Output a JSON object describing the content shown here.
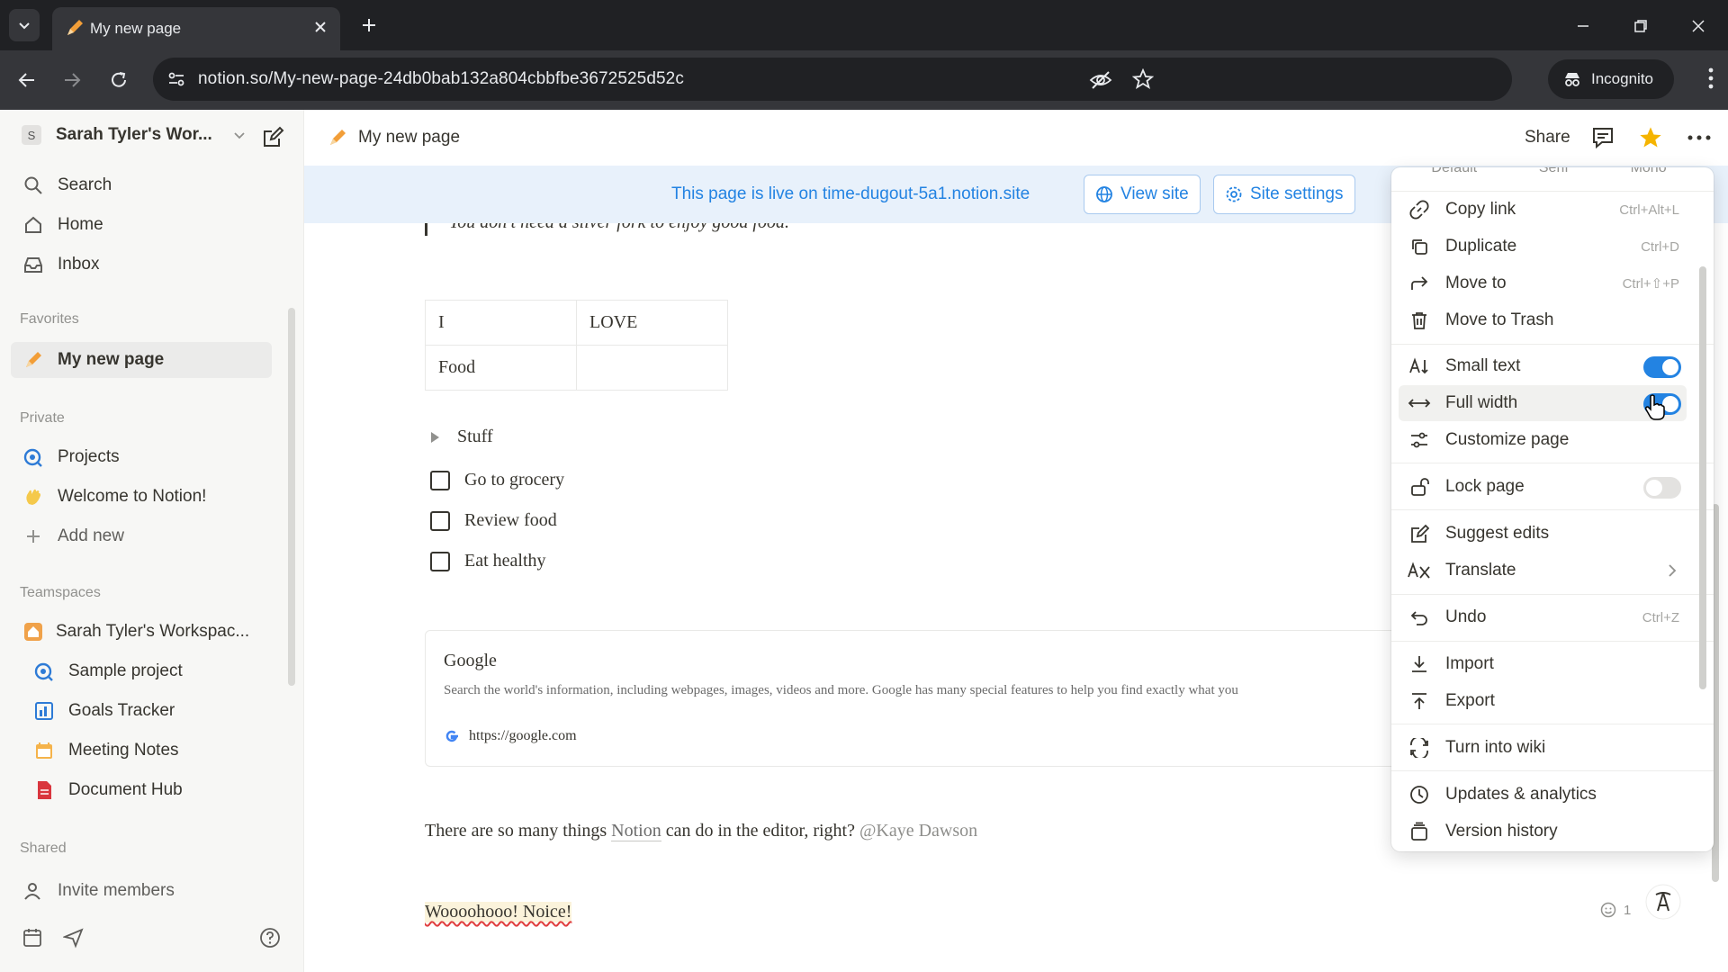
{
  "browser": {
    "tab_title": "My new page",
    "url": "notion.so/My-new-page-24db0bab132a804cbbfbe3672525d52c",
    "incognito_label": "Incognito"
  },
  "sidebar": {
    "workspace_initial": "S",
    "workspace_name": "Sarah Tyler's Wor...",
    "top_items": [
      {
        "label": "Search",
        "icon": "search-icon"
      },
      {
        "label": "Home",
        "icon": "home-icon"
      },
      {
        "label": "Inbox",
        "icon": "inbox-icon"
      }
    ],
    "favorites_heading": "Favorites",
    "favorites": [
      {
        "label": "My new page",
        "icon": "pencil-icon"
      }
    ],
    "private_heading": "Private",
    "private": [
      {
        "label": "Projects",
        "icon": "projects-icon"
      },
      {
        "label": "Welcome to Notion!",
        "icon": "wave-hand-icon"
      },
      {
        "label": "Add new",
        "icon": "plus-icon"
      }
    ],
    "teamspaces_heading": "Teamspaces",
    "teamspaces": [
      {
        "label": "Sarah Tyler's Workspac...",
        "icon": "house-icon"
      },
      {
        "label": "Sample project",
        "icon": "projects-icon"
      },
      {
        "label": "Goals Tracker",
        "icon": "chart-icon"
      },
      {
        "label": "Meeting Notes",
        "icon": "calendar-icon"
      },
      {
        "label": "Document Hub",
        "icon": "document-icon"
      }
    ],
    "shared_heading": "Shared",
    "invite_label": "Invite members"
  },
  "topbar": {
    "breadcrumb": "My new page",
    "share_label": "Share"
  },
  "banner": {
    "message": "This page is live on time-dugout-5a1.notion.site",
    "view_site": "View site",
    "site_settings": "Site settings"
  },
  "page": {
    "quote": "You don't need a silver fork to enjoy good food.",
    "table": [
      [
        "I",
        "LOVE"
      ],
      [
        "Food",
        ""
      ]
    ],
    "toggle": "Stuff",
    "todos": [
      "Go to grocery",
      "Review food",
      "Eat healthy"
    ],
    "bookmark": {
      "title": "Google",
      "description": "Search the world's information, including webpages, images, videos and more. Google has many special features to help you find exactly what you",
      "url": "https://google.com"
    },
    "para1_a": "There are so many things ",
    "para1_link": "Notion",
    "para1_b": " can do in the editor, right? ",
    "para1_mention": "@Kaye Dawson",
    "para2": "Woooohooo! Noice!",
    "reaction_count": "1"
  },
  "menu": {
    "fonts": [
      "Default",
      "Serif",
      "Mono"
    ],
    "items": [
      {
        "label": "Copy link",
        "shortcut": "Ctrl+Alt+L",
        "icon": "link-icon"
      },
      {
        "label": "Duplicate",
        "shortcut": "Ctrl+D",
        "icon": "duplicate-icon"
      },
      {
        "label": "Move to",
        "shortcut": "Ctrl+⇧+P",
        "icon": "move-arrow-icon"
      },
      {
        "label": "Move to Trash",
        "shortcut": "",
        "icon": "trash-icon"
      },
      {
        "label": "Small text",
        "toggle": true,
        "icon": "small-text-icon"
      },
      {
        "label": "Full width",
        "toggle": true,
        "icon": "full-width-icon"
      },
      {
        "label": "Customize page",
        "icon": "sliders-icon"
      },
      {
        "label": "Lock page",
        "toggle": false,
        "icon": "lock-icon"
      },
      {
        "label": "Suggest edits",
        "icon": "suggest-edit-icon"
      },
      {
        "label": "Translate",
        "icon": "translate-icon"
      },
      {
        "label": "Undo",
        "shortcut": "Ctrl+Z",
        "icon": "undo-icon"
      },
      {
        "label": "Import",
        "icon": "import-icon"
      },
      {
        "label": "Export",
        "icon": "export-icon"
      },
      {
        "label": "Turn into wiki",
        "icon": "wiki-icon"
      },
      {
        "label": "Updates & analytics",
        "icon": "clock-icon"
      },
      {
        "label": "Version history",
        "icon": "version-history-icon"
      }
    ]
  },
  "colors": {
    "accent": "#2383e2",
    "banner_bg": "#e8f1fb",
    "sidebar_bg": "#f7f7f5",
    "star": "#f5b400"
  }
}
